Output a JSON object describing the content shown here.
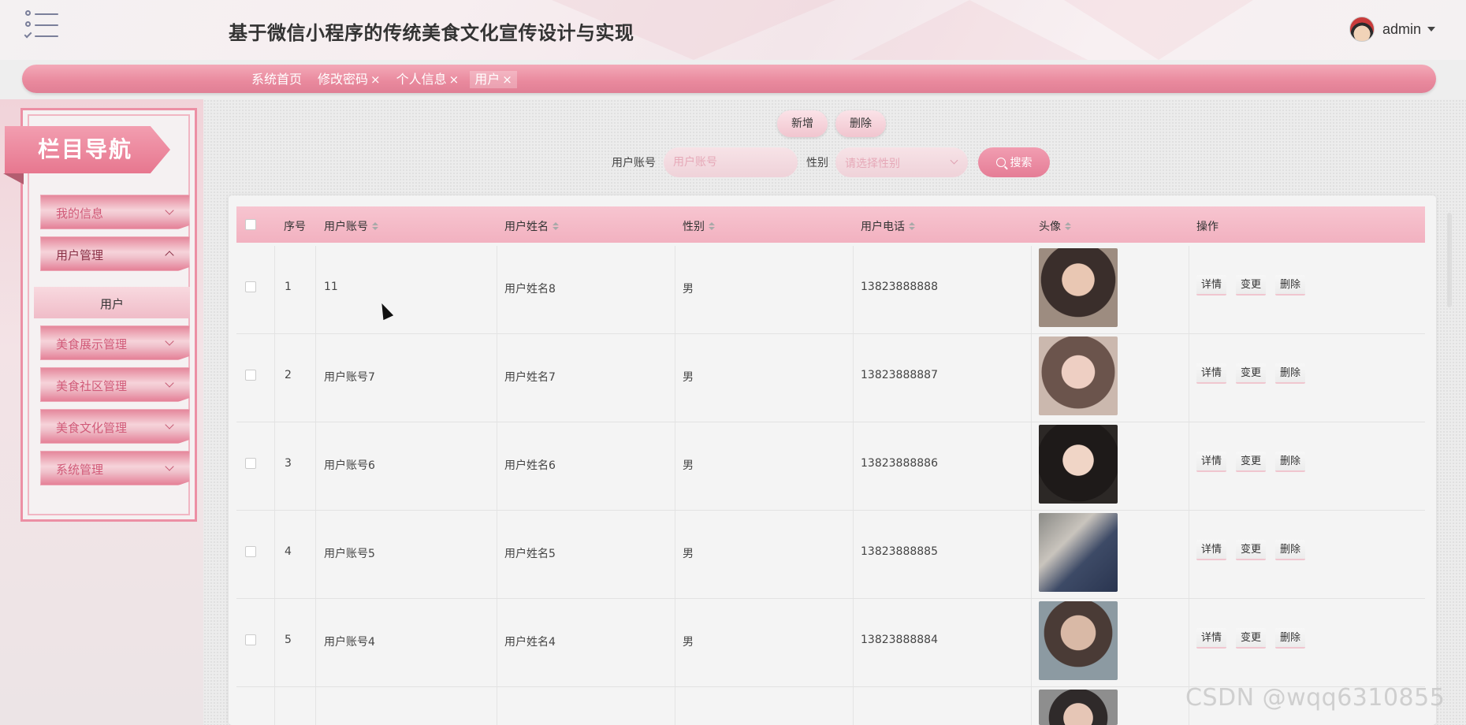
{
  "header": {
    "title": "基于微信小程序的传统美食文化宣传设计与实现",
    "user": "admin"
  },
  "tabs": [
    {
      "label": "系统首页",
      "close": ""
    },
    {
      "label": "修改密码",
      "close": "×"
    },
    {
      "label": "个人信息",
      "close": "×"
    },
    {
      "label": "用户",
      "close": "×"
    }
  ],
  "sidebar": {
    "title": "栏目导航",
    "items": [
      {
        "label": "我的信息"
      },
      {
        "label": "用户管理"
      },
      {
        "label": "美食展示管理"
      },
      {
        "label": "美食社区管理"
      },
      {
        "label": "美食文化管理"
      },
      {
        "label": "系统管理"
      }
    ],
    "sub_item": "用户"
  },
  "toolbar": {
    "add_label": "新增",
    "delete_label": "删除",
    "account_label": "用户账号",
    "account_placeholder": "用户账号",
    "gender_label": "性别",
    "gender_placeholder": "请选择性别",
    "search_label": "搜索"
  },
  "table": {
    "headers": {
      "index": "序号",
      "account": "用户账号",
      "name": "用户姓名",
      "gender": "性别",
      "phone": "用户电话",
      "avatar": "头像",
      "actions": "操作"
    },
    "rows": [
      {
        "index": "1",
        "account": "11",
        "name": "用户姓名8",
        "gender": "男",
        "phone": "13823888888"
      },
      {
        "index": "2",
        "account": "用户账号7",
        "name": "用户姓名7",
        "gender": "男",
        "phone": "13823888887"
      },
      {
        "index": "3",
        "account": "用户账号6",
        "name": "用户姓名6",
        "gender": "男",
        "phone": "13823888886"
      },
      {
        "index": "4",
        "account": "用户账号5",
        "name": "用户姓名5",
        "gender": "男",
        "phone": "13823888885"
      },
      {
        "index": "5",
        "account": "用户账号4",
        "name": "用户姓名4",
        "gender": "男",
        "phone": "13823888884"
      }
    ],
    "actions": {
      "detail": "详情",
      "edit": "变更",
      "delete": "删除"
    }
  },
  "watermark": "CSDN @wqq6310855",
  "colors": {
    "accent": "#e9899d",
    "accent_light": "#f7c5d0"
  }
}
